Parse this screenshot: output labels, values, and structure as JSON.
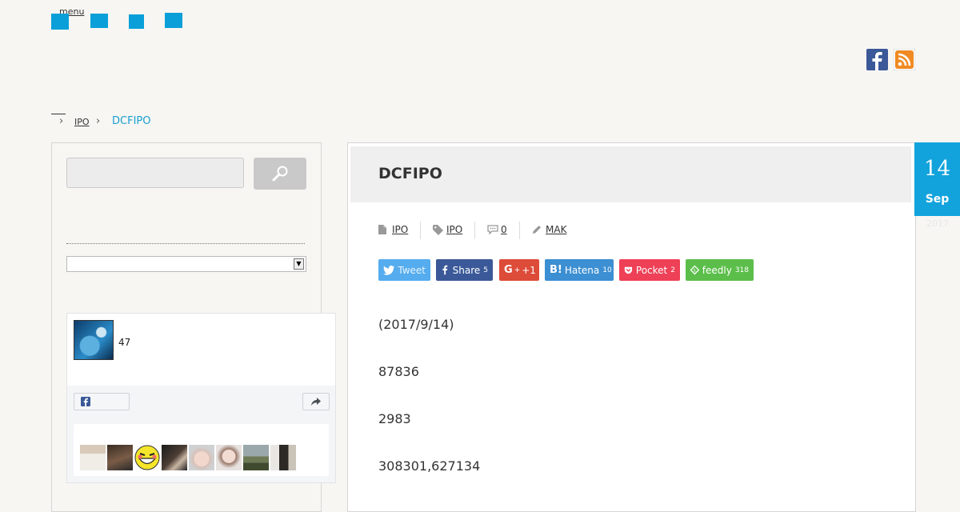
{
  "header": {
    "menu_label": "menu"
  },
  "breadcrumb": {
    "items": [
      "IPO"
    ],
    "current": "DCFIPO"
  },
  "widget": {
    "follower_count": "47"
  },
  "article": {
    "title": "DCFIPO",
    "date": {
      "day": "14",
      "month": "Sep",
      "year": "2017"
    },
    "meta": {
      "category": "IPO",
      "tag": "IPO",
      "comments": "0",
      "author": "MAK"
    },
    "share": {
      "tweet": {
        "label": "Tweet"
      },
      "facebook": {
        "label": "Share",
        "count": "5"
      },
      "gplus": {
        "label": "+1"
      },
      "hatena": {
        "label": "Hatena",
        "count": "10"
      },
      "pocket": {
        "label": "Pocket",
        "count": "2"
      },
      "feedly": {
        "label": "feedly",
        "count": "318"
      }
    },
    "paragraphs": [
      "(2017/9/14)",
      "87836",
      "2983",
      "308301,627134"
    ]
  },
  "colors": {
    "accent": "#0a9fd8",
    "tweet": "#55acee",
    "facebook": "#3b5998",
    "gplus": "#dd4b39",
    "hatena": "#3c8fd2",
    "pocket": "#ee4056",
    "feedly": "#5cbe4a"
  }
}
